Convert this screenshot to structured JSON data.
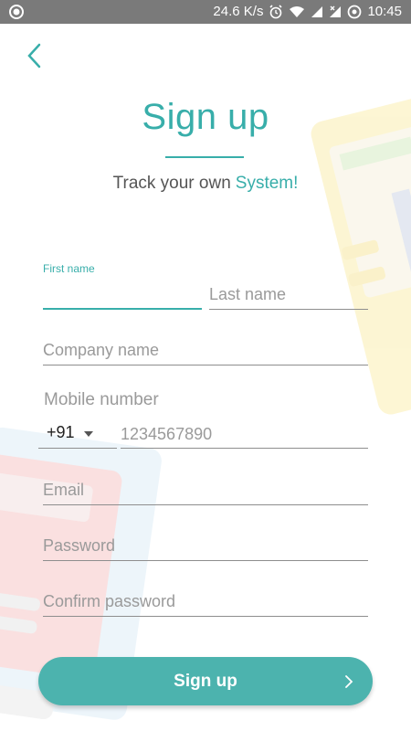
{
  "status": {
    "speed": "24.6 K/s",
    "time": "10:45"
  },
  "header": {
    "title": "Sign up",
    "subtitle_prefix": "Track your own",
    "subtitle_accent": "System!"
  },
  "form": {
    "first_name_label": "First name",
    "last_name_placeholder": "Last name",
    "company_placeholder": "Company name",
    "mobile_label": "Mobile number",
    "country_code": "+91",
    "mobile_placeholder": "1234567890",
    "email_placeholder": "Email",
    "password_placeholder": "Password",
    "confirm_password_placeholder": "Confirm password"
  },
  "actions": {
    "signup_label": "Sign up"
  },
  "colors": {
    "accent": "#38aeaa",
    "button": "#4cb3ae",
    "statusbar": "#7a7a7a"
  }
}
